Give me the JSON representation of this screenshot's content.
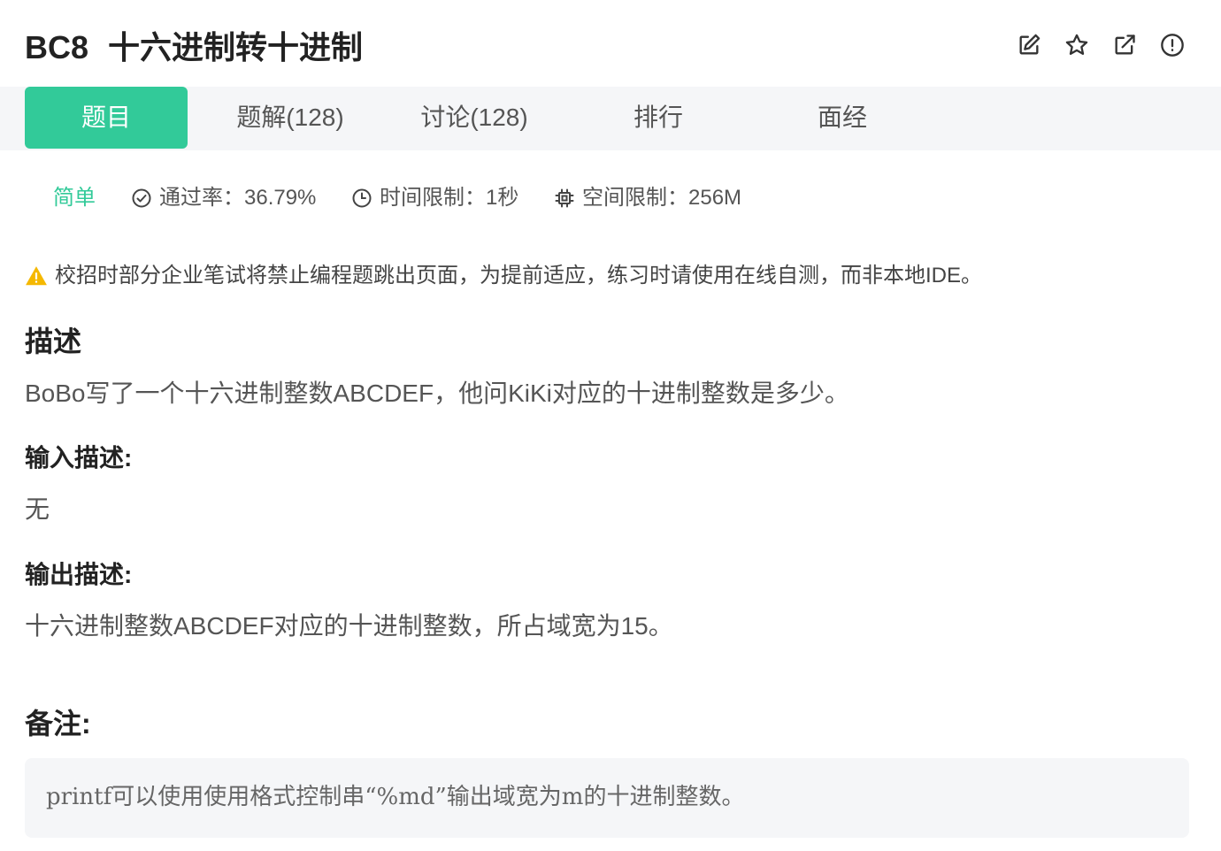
{
  "problem": {
    "code": "BC8",
    "title": "十六进制转十进制"
  },
  "header_icons": [
    "edit-icon",
    "star-icon",
    "external-link-icon",
    "alert-circle-icon"
  ],
  "tabs": [
    {
      "label": "题目",
      "active": true
    },
    {
      "label": "题解(128)",
      "active": false
    },
    {
      "label": "讨论(128)",
      "active": false
    },
    {
      "label": "排行",
      "active": false
    },
    {
      "label": "面经",
      "active": false
    }
  ],
  "meta": {
    "difficulty": "简单",
    "pass_rate": "通过率：36.79%",
    "time_limit": "时间限制：1秒",
    "space_limit": "空间限制：256M"
  },
  "warning": "校招时部分企业笔试将禁止编程题跳出页面，为提前适应，练习时请使用在线自测，而非本地IDE。",
  "sections": {
    "description_heading": "描述",
    "description": "BoBo写了一个十六进制整数ABCDEF，他问KiKi对应的十进制整数是多少。",
    "input_heading": "输入描述:",
    "input": "无",
    "output_heading": "输出描述:",
    "output": "十六进制整数ABCDEF对应的十进制整数，所占域宽为15。",
    "note_heading": "备注:",
    "note": "printf可以使用使用格式控制串“%md”输出域宽为m的十进制整数。"
  },
  "colors": {
    "accent": "#32ca99",
    "tabbar_bg": "#f5f6f8",
    "warning": "#f5b800"
  }
}
